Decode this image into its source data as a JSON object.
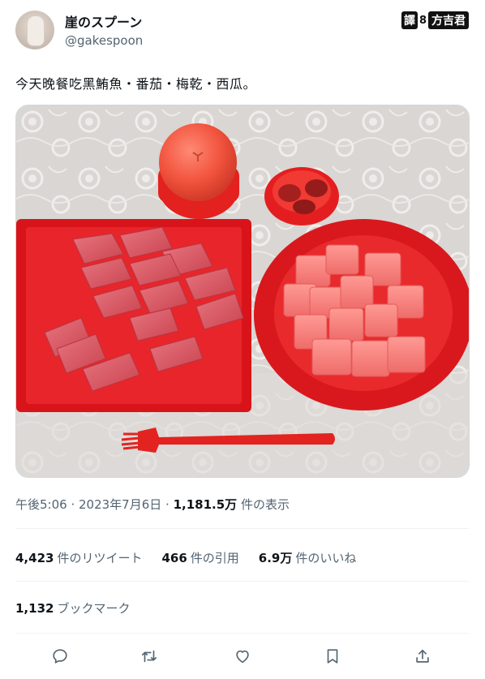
{
  "author": {
    "display_name": "崖のスプーン",
    "handle": "@gakespoon"
  },
  "watermark": {
    "part1": "譯",
    "part2": "8",
    "part3": "方吉君"
  },
  "tweet": {
    "text": "今天晚餐吃黑鮪魚・番茄・梅乾・西瓜。"
  },
  "meta": {
    "time": "午後5:06",
    "sep1": " · ",
    "date": "2023年7月6日",
    "sep2": " · ",
    "views": "1,181.5万",
    "views_label": " 件の表示"
  },
  "stats": {
    "retweets": "4,423",
    "retweets_label": "件のリツイート",
    "quotes": "466",
    "quotes_label": "件の引用",
    "likes": "6.9万",
    "likes_label": "件のいいね"
  },
  "bookmarks": {
    "count": "1,132",
    "label": "ブックマーク"
  },
  "icons": {
    "reply": "reply-icon",
    "retweet": "retweet-icon",
    "like": "like-icon",
    "bookmark": "bookmark-icon",
    "share": "share-icon"
  },
  "colors": {
    "text": "#0f1419",
    "secondary": "#536471",
    "divider": "#eff3f4",
    "tray_red": "#d8141a"
  }
}
